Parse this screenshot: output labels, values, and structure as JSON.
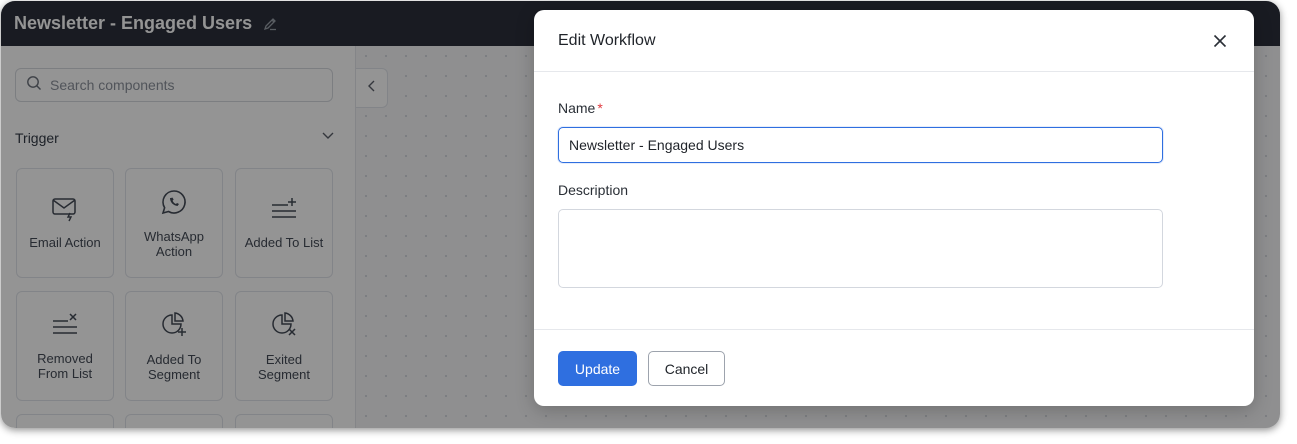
{
  "app": {
    "title": "Newsletter - Engaged Users",
    "edit_icon": "pencil-icon"
  },
  "sidebar": {
    "search_placeholder": "Search components",
    "section_title": "Trigger",
    "components": [
      {
        "label": "Email Action",
        "icon": "email-action-icon"
      },
      {
        "label": "WhatsApp Action",
        "icon": "whatsapp-icon"
      },
      {
        "label": "Added To List",
        "icon": "list-add-icon"
      },
      {
        "label": "Removed From List",
        "icon": "list-remove-icon"
      },
      {
        "label": "Added To Segment",
        "icon": "segment-add-icon"
      },
      {
        "label": "Exited Segment",
        "icon": "segment-exit-icon"
      }
    ]
  },
  "modal": {
    "title": "Edit Workflow",
    "name_label": "Name",
    "required_marker": "*",
    "name_value": "Newsletter - Engaged Users",
    "description_label": "Description",
    "description_value": "",
    "update_label": "Update",
    "cancel_label": "Cancel"
  },
  "colors": {
    "primary": "#2f6fe0",
    "topbar": "#2b303b",
    "required": "#e0393e"
  }
}
